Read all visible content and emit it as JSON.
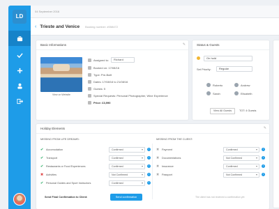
{
  "date": "04 September 2016",
  "trip_title": "Trieste and Venice",
  "booking_number": "Booking number: #058472",
  "logo": "LD",
  "nav": [
    {
      "name": "nav-bookings-icon"
    },
    {
      "name": "nav-check-icon"
    },
    {
      "name": "nav-add-icon"
    },
    {
      "name": "nav-user-icon"
    },
    {
      "name": "nav-logout-icon"
    }
  ],
  "basic": {
    "title": "Basic Informations",
    "view_web": "View on Website",
    "assigned_label": "Assigned to:",
    "assigned_value": "Richard",
    "booked_on": "Booked on: 17/08/16",
    "type": "Type: Pre-Built",
    "dates": "Dates: 17/08/16 to 21/08/16",
    "guests": "Guests: 5",
    "requests": "Special Requests: Personal Photographer, Wine Experience",
    "price": "Price: £3,990"
  },
  "status": {
    "title": "Status & Guests",
    "status_value": "On hold",
    "priority_label": "Set Priority:",
    "priority_value": "Regular",
    "guests": [
      "Roberto",
      "Andrew",
      "Sarah",
      "Elisabeth"
    ],
    "all_guests": "View All Guests",
    "total": "TOT: 4 Guests"
  },
  "holiday": {
    "title": "Holiday Elements",
    "left_title": "MISSING FROM LIFE DREAMS:",
    "right_title": "MISSING FROM THE CLIENT:",
    "left_rows": [
      {
        "label": "Accomodation",
        "status": "Confirmed",
        "mark": "ok"
      },
      {
        "label": "Transport",
        "status": "Confirmed",
        "mark": "ok"
      },
      {
        "label": "Restaurants or Food Experiences",
        "status": "Confirmed",
        "mark": "ok"
      },
      {
        "label": "Activities",
        "status": "Not Confirmed",
        "mark": "no"
      },
      {
        "label": "Personal Guides and Sport Instructors",
        "status": "Confirmed",
        "mark": "ok"
      }
    ],
    "right_rows": [
      {
        "label": "Payment",
        "status": "Confirmed"
      },
      {
        "label": "Documentations",
        "status": "Not Confirmed"
      },
      {
        "label": "Insurance",
        "status": "Confirmed"
      },
      {
        "label": "Passport",
        "status": "Not Confirmed"
      }
    ],
    "send_label": "Send Final Confirmation to Client:",
    "send_button": "Send confirmation",
    "note": "The client has not received a confirmation yet"
  }
}
